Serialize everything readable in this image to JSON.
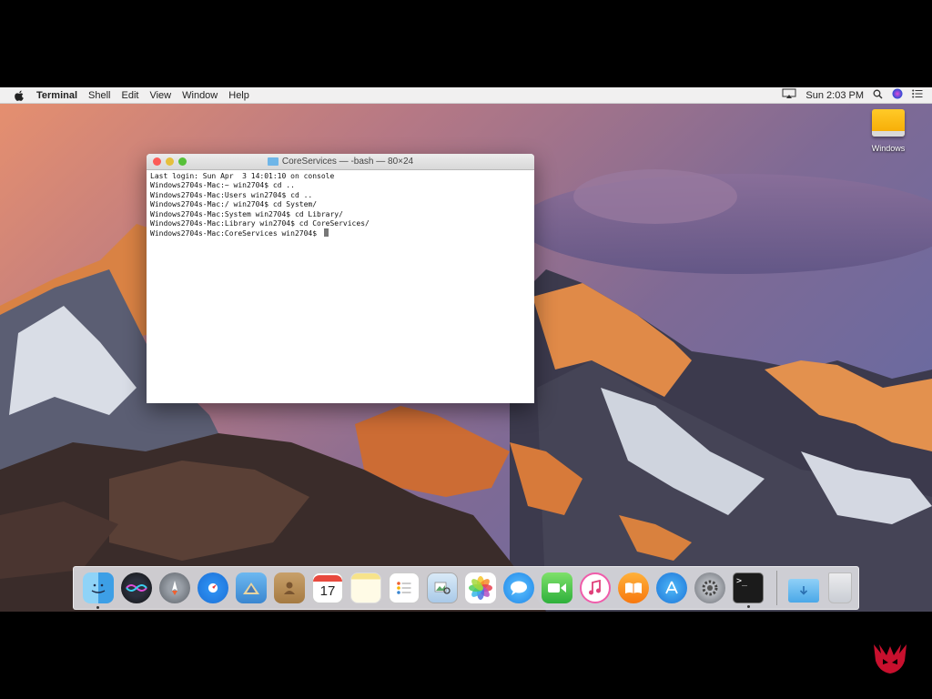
{
  "menubar": {
    "app_name": "Terminal",
    "items": [
      "Shell",
      "Edit",
      "View",
      "Window",
      "Help"
    ],
    "clock": "Sun 2:03 PM",
    "icons": [
      "apple-icon",
      "airplay-icon",
      "search-icon",
      "siri-icon",
      "notification-center-icon"
    ]
  },
  "desktop": {
    "icon_label": "Windows"
  },
  "terminal": {
    "title": "CoreServices — -bash — 80×24",
    "lines": [
      "Last login: Sun Apr  3 14:01:10 on console",
      "Windows2704s-Mac:~ win2704$ cd ..",
      "Windows2704s-Mac:Users win2704$ cd ..",
      "Windows2704s-Mac:/ win2704$ cd System/",
      "Windows2704s-Mac:System win2704$ cd Library/",
      "Windows2704s-Mac:Library win2704$ cd CoreServices/",
      "Windows2704s-Mac:CoreServices win2704$ "
    ]
  },
  "dock": {
    "apps": [
      "finder-icon",
      "siri-icon",
      "launchpad-icon",
      "safari-icon",
      "mail-icon",
      "contacts-icon",
      "calendar-icon",
      "notes-icon",
      "reminders-icon",
      "preview-icon",
      "photos-icon",
      "messages-icon",
      "facetime-icon",
      "itunes-icon",
      "ibooks-icon",
      "app-store-icon",
      "system-preferences-icon",
      "terminal-icon"
    ],
    "calendar_day": "17",
    "terminal_glyph": ">_",
    "extras": [
      "downloads-folder-icon",
      "trash-icon"
    ]
  },
  "colors": {
    "menubar_bg": "#f1f0f0",
    "terminal_bg": "#ffffff",
    "close": "#fc5b57",
    "minimize": "#e5bf3c",
    "zoom": "#57c038",
    "brand_logo": "#c8102e"
  }
}
